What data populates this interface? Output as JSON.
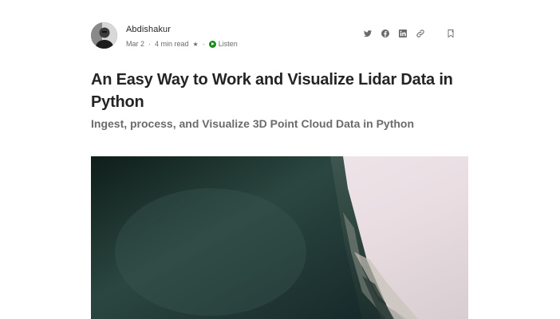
{
  "author": {
    "name": "Abdishakur",
    "date": "Mar 2",
    "separator": "·",
    "read_time": "4 min read",
    "member_star": "★",
    "listen_label": "Listen"
  },
  "share": {
    "icons": [
      "twitter-icon",
      "facebook-icon",
      "linkedin-icon",
      "link-icon",
      "bookmark-icon"
    ]
  },
  "article": {
    "title": "An Easy Way to Work and Visualize Lidar Data in Python",
    "subtitle": "Ingest, process, and Visualize 3D Point Cloud Data in Python"
  },
  "colors": {
    "text": "#242424",
    "muted": "#6b6b6b",
    "listen_green": "#1a8917",
    "hero_dark": "#1f3530",
    "hero_light": "#efe6ea"
  }
}
